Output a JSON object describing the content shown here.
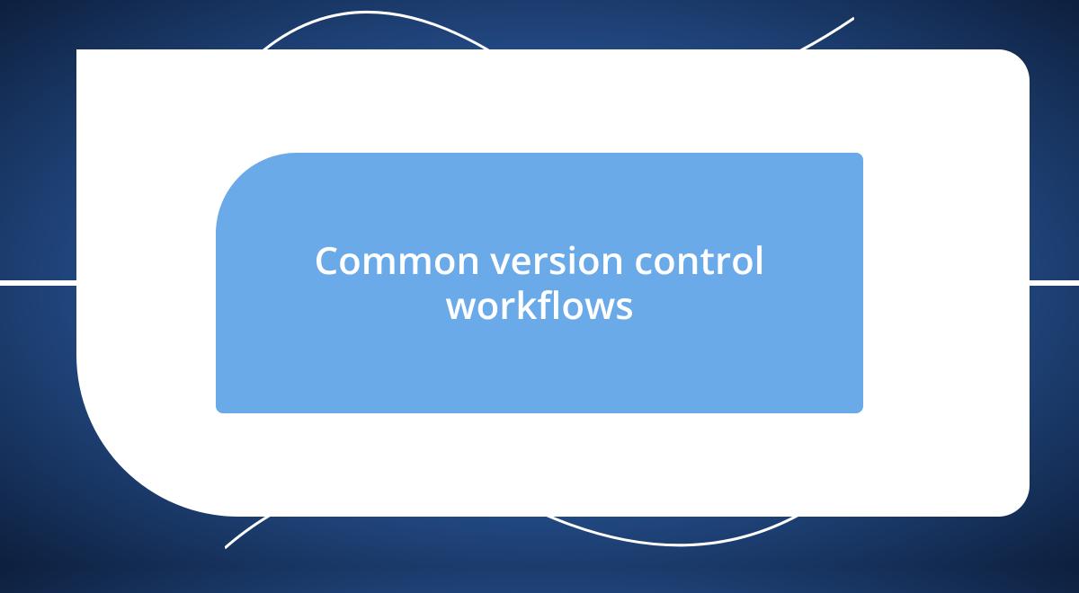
{
  "card": {
    "title": "Common version control workflows"
  }
}
